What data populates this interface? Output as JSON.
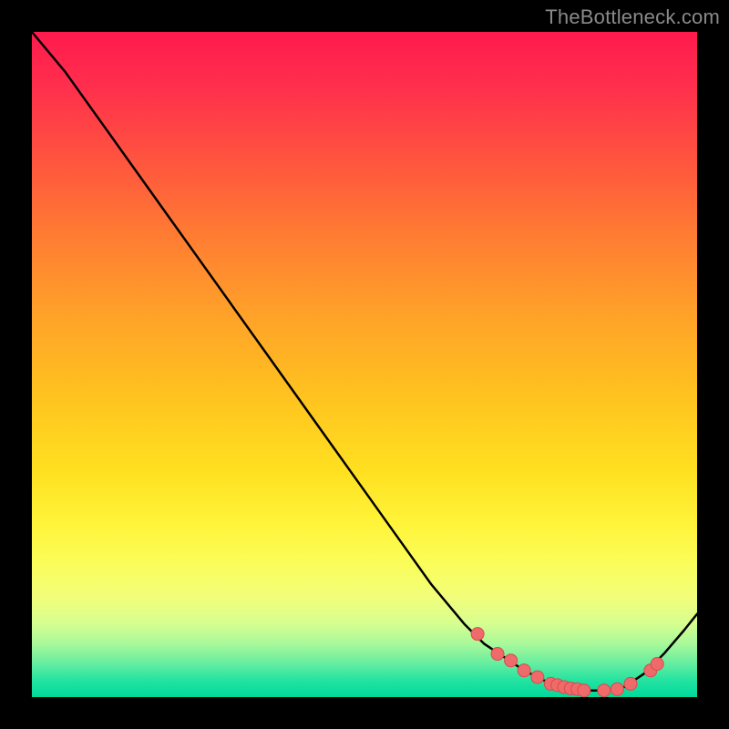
{
  "watermark": "TheBottleneck.com",
  "chart_data": {
    "type": "line",
    "title": "",
    "xlabel": "",
    "ylabel": "",
    "xlim": [
      0,
      100
    ],
    "ylim": [
      0,
      100
    ],
    "curve": {
      "x": [
        0,
        5,
        10,
        15,
        20,
        25,
        30,
        35,
        40,
        45,
        50,
        55,
        60,
        65,
        68,
        71,
        74,
        77,
        80,
        83,
        86,
        89,
        92,
        95,
        98,
        100
      ],
      "y": [
        100,
        94,
        87,
        80,
        73,
        66,
        59,
        52,
        45,
        38,
        31,
        24,
        17,
        11,
        8,
        6,
        4,
        2.5,
        1.5,
        1,
        1,
        1.5,
        3.5,
        6.5,
        10,
        12.5
      ]
    },
    "points": {
      "x": [
        67,
        70,
        72,
        74,
        76,
        78,
        79,
        80,
        81,
        82,
        83,
        86,
        88,
        90,
        93,
        94
      ],
      "y": [
        9.5,
        6.5,
        5.5,
        4,
        3,
        2,
        1.8,
        1.5,
        1.3,
        1.2,
        1,
        1,
        1.2,
        2,
        4,
        5
      ]
    },
    "colors": {
      "line": "#000000",
      "point_fill": "#ef6a6a",
      "point_stroke": "#d94b4b"
    }
  }
}
